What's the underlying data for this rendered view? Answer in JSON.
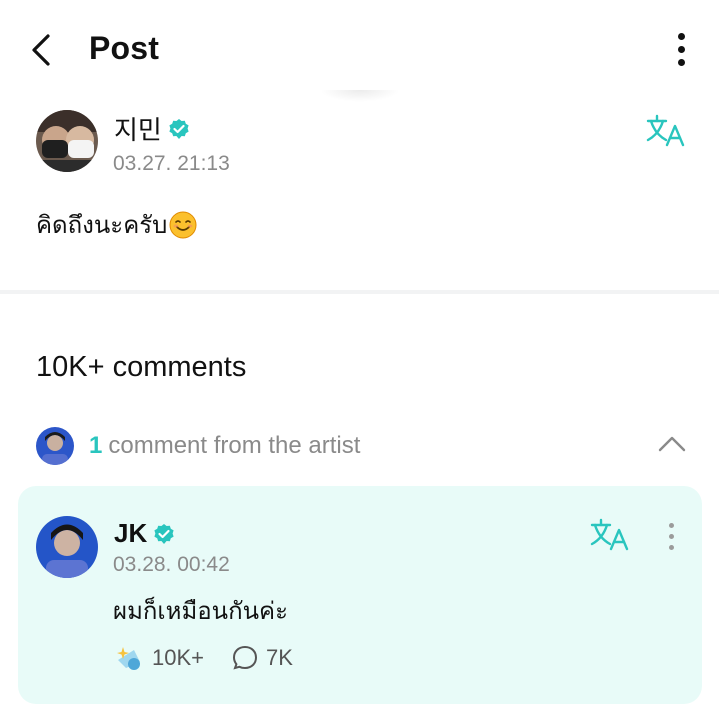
{
  "header": {
    "title": "Post",
    "accent_color": "#29c5be"
  },
  "post": {
    "author": "지민",
    "timestamp": "03.27. 21:13",
    "body": "คิดถึงนะครับ",
    "emoji": "smiling-face-emoji"
  },
  "comments": {
    "count_label": "10K+ comments",
    "artist_section": {
      "count": "1",
      "label": "comment from the artist"
    },
    "artist_comment": {
      "author": "JK",
      "timestamp": "03.28. 00:42",
      "body": "ผมก็เหมือนกันค่ะ",
      "likes": "10K+",
      "replies": "7K",
      "background_color": "#e8fbf8"
    }
  }
}
